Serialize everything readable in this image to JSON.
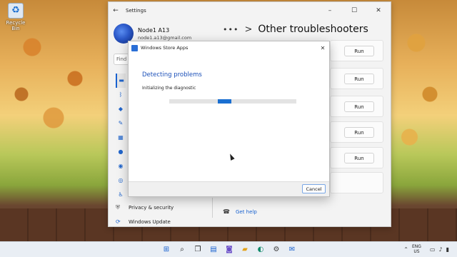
{
  "desktop": {
    "recycle_bin_label": "Recycle Bin"
  },
  "settings": {
    "window_title": "Settings",
    "back_icon": "arrow-left-icon",
    "controls": {
      "minimize": "–",
      "maximize": "☐",
      "close": "✕"
    },
    "user": {
      "name": "Node1 A13",
      "email": "node1.a13@gmail.com"
    },
    "search_placeholder": "Find",
    "header": {
      "overflow": "•••",
      "separator": ">",
      "title": "Other troubleshooters"
    },
    "run_label": "Run",
    "bottom_nav": [
      {
        "label": "Privacy & security",
        "icon": "shield-icon"
      },
      {
        "label": "Windows Update",
        "icon": "update-icon"
      }
    ],
    "get_help": "Get help"
  },
  "dialog": {
    "title": "Windows Store Apps",
    "heading": "Detecting problems",
    "status": "Initializing the diagnostic",
    "cancel_label": "Cancel",
    "progress_state": "indeterminate"
  },
  "taskbar": {
    "icons": [
      "windows-start-icon",
      "search-icon",
      "task-view-icon",
      "widgets-icon",
      "chat-icon",
      "file-explorer-icon",
      "edge-icon",
      "settings-icon",
      "outlook-icon"
    ],
    "language": {
      "line1": "ENG",
      "line2": "US"
    }
  },
  "colors": {
    "accent": "#1a63d0",
    "dialog_heading": "#1a4fb8"
  }
}
